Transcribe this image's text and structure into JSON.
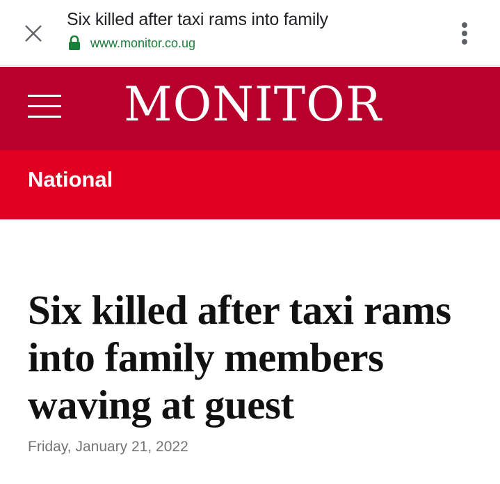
{
  "browser": {
    "page_title": "Six killed after taxi rams into family",
    "url": "www.monitor.co.ug",
    "icons": {
      "close": "close-icon",
      "lock": "lock-icon",
      "menu": "more-vert-icon"
    },
    "colors": {
      "url": "#188038",
      "lock": "#188038"
    }
  },
  "site": {
    "logo": "MONITOR",
    "menu_icon": "hamburger-icon",
    "colors": {
      "masthead": "#b8002d",
      "section_bar": "#e00022"
    }
  },
  "section": {
    "label": "National"
  },
  "article": {
    "headline": "Six killed after taxi rams into family members waving at guest",
    "date": "Friday, January 21, 2022"
  }
}
